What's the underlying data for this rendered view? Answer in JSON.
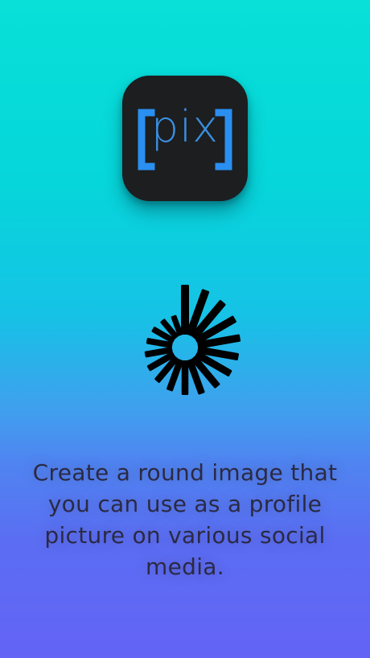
{
  "app_icon": {
    "label": "pix",
    "colors": {
      "background": "#1c1e20",
      "brackets": "#2a8ff0",
      "text": "#3a8fe0"
    }
  },
  "loading_indicator": {
    "icon": "spinner-icon",
    "color": "#000000"
  },
  "caption": {
    "text": "Create a round image that you can use as a profile picture on various social media."
  },
  "colors": {
    "gradient_top": "#08e0d8",
    "gradient_bottom": "#6363f5"
  }
}
